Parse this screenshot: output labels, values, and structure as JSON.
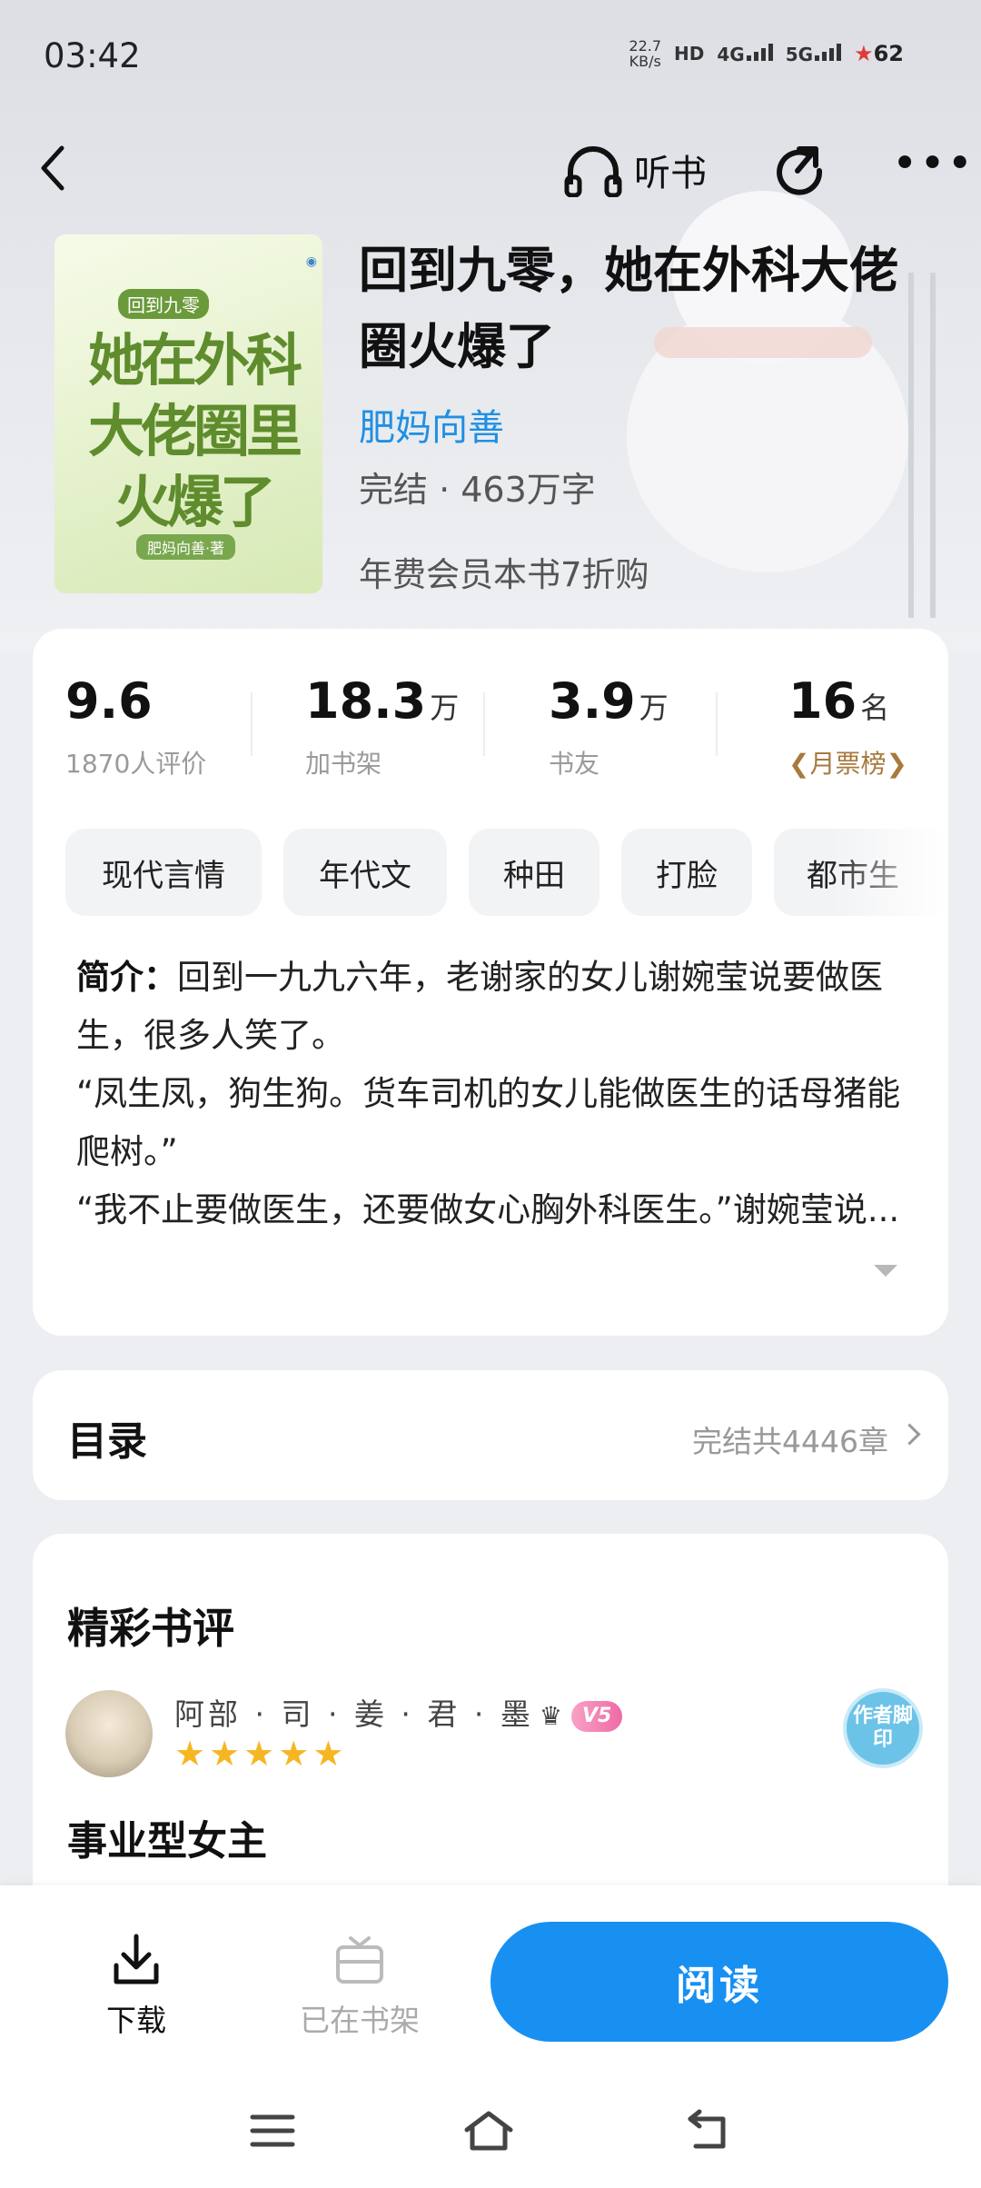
{
  "status_bar": {
    "time": "03:42",
    "speed_value": "22.7",
    "speed_unit": "KB/s",
    "hd_label": "HD",
    "net1": "4G",
    "net2": "5G",
    "battery": "62"
  },
  "nav": {
    "listen_label": "听书"
  },
  "book": {
    "cover_tag": "回到九零",
    "cover_title": "她在外科大佬圈里火爆了",
    "cover_author": "肥妈向善·著",
    "title": "回到九零，她在外科大佬圈火爆了",
    "author": "肥妈向善",
    "meta": "完结 · 463万字",
    "promo": "年费会员本书7折购"
  },
  "stats": [
    {
      "value": "9.6",
      "unit": "",
      "label": "1870人评价"
    },
    {
      "value": "18.3",
      "unit": "万",
      "label": "加书架"
    },
    {
      "value": "3.9",
      "unit": "万",
      "label": "书友"
    },
    {
      "value": "16",
      "unit": "名",
      "label": "月票榜"
    }
  ],
  "tags": [
    "现代言情",
    "年代文",
    "种田",
    "打脸",
    "都市生"
  ],
  "intro": {
    "label": "简介：",
    "lines": [
      "回到一九九六年，老谢家的女儿谢婉莹说要做医生，很多人笑了。",
      "“凤生凤，狗生狗。货车司机的女儿能做医生的话母猪能爬树。”",
      "“我不止要做医生，还要做女心胸外科医生。”谢婉莹说..."
    ]
  },
  "toc": {
    "title": "目录",
    "info": "完结共4446章"
  },
  "reviews": {
    "title": "精彩书评",
    "user": "阿部 · 司 · 姜 · 君 · 墨",
    "level_badge": "V5",
    "rating": 5,
    "stamp": "作者脚印",
    "heading": "事业型女主"
  },
  "bottom_bar": {
    "download": "下载",
    "on_shelf": "已在书架",
    "read": "阅读"
  }
}
